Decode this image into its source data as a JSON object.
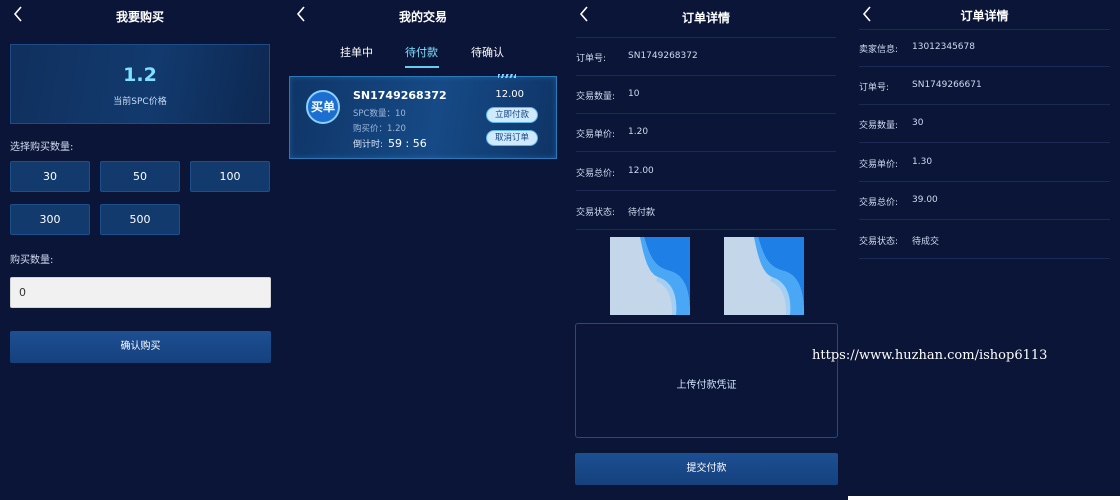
{
  "colors": {
    "background": "#0b1538",
    "accent": "#7fe0ff",
    "button": "#1d4f93"
  },
  "buy_screen": {
    "title": "我要购买",
    "price_value": "1.2",
    "price_label": "当前SPC价格",
    "select_label": "选择购买数量:",
    "quantity_options": [
      "30",
      "50",
      "100",
      "300",
      "500"
    ],
    "amount_label": "购买数量:",
    "amount_value": "0",
    "confirm_label": "确认购买"
  },
  "trades_screen": {
    "title": "我的交易",
    "tabs": [
      {
        "label": "挂单中",
        "active": false
      },
      {
        "label": "待付款",
        "active": true
      },
      {
        "label": "待确认",
        "active": false
      }
    ],
    "order": {
      "badge": "买单",
      "sn": "SN1749268372",
      "spc_qty": "SPC数量：10",
      "buy_price": "购买价：1.20",
      "countdown_label": "倒计时:",
      "countdown_value": "59 : 56",
      "amount": "12.00",
      "pay_label": "立即付款",
      "cancel_label": "取消订单"
    }
  },
  "detail_pay_screen": {
    "title": "订单详情",
    "rows": [
      {
        "label": "订单号:",
        "value": "SN1749268372"
      },
      {
        "label": "交易数量:",
        "value": "10"
      },
      {
        "label": "交易单价:",
        "value": "1.20"
      },
      {
        "label": "交易总价:",
        "value": "12.00"
      },
      {
        "label": "交易状态:",
        "value": "待付款"
      }
    ],
    "upload_label": "上传付款凭证",
    "submit_label": "提交付款"
  },
  "detail_seller_screen": {
    "title": "订单详情",
    "rows": [
      {
        "label": "卖家信息:",
        "value": "13012345678"
      },
      {
        "label": "订单号:",
        "value": "SN1749266671"
      },
      {
        "label": "交易数量:",
        "value": "30"
      },
      {
        "label": "交易单价:",
        "value": "1.30"
      },
      {
        "label": "交易总价:",
        "value": "39.00"
      },
      {
        "label": "交易状态:",
        "value": "待成交"
      }
    ]
  },
  "watermark": "https://www.huzhan.com/ishop6113"
}
